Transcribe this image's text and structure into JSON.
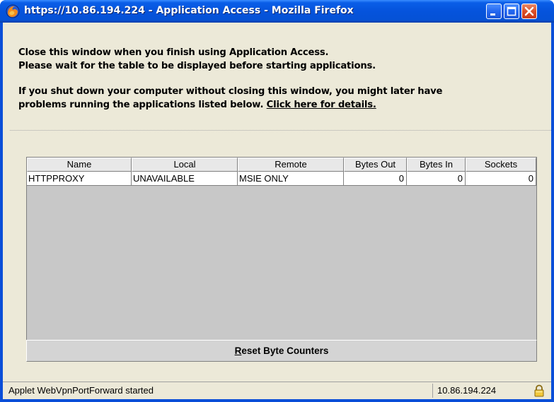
{
  "window": {
    "title": "https://10.86.194.224 - Application Access - Mozilla Firefox"
  },
  "messages": {
    "line1": "Close this window when you finish using Application Access.",
    "line2": "Please wait for the table to be displayed before starting applications.",
    "line3": "If you shut down your computer without closing this window, you might later have",
    "line4_prefix": "problems running the applications listed below. ",
    "details_link": "Click here for details."
  },
  "table": {
    "columns": [
      "Name",
      "Local",
      "Remote",
      "Bytes Out",
      "Bytes In",
      "Sockets"
    ],
    "rows": [
      {
        "name": "HTTPPROXY",
        "local": "UNAVAILABLE",
        "remote": "MSIE ONLY",
        "bytes_out": "0",
        "bytes_in": "0",
        "sockets": "0"
      }
    ]
  },
  "reset_button": {
    "label_first": "R",
    "label_rest": "eset Byte Counters"
  },
  "statusbar": {
    "text": "Applet WebVpnPortForward started",
    "host": "10.86.194.224"
  },
  "colors": {
    "titlebar": "#0553dc",
    "close_button": "#dc4f27",
    "dialog_background": "#ece9d8",
    "table_background": "#c8c8c8"
  },
  "icons": {
    "app": "firefox-icon",
    "minimize": "minimize-icon",
    "maximize": "maximize-icon",
    "close": "close-icon",
    "security": "lock-icon"
  }
}
